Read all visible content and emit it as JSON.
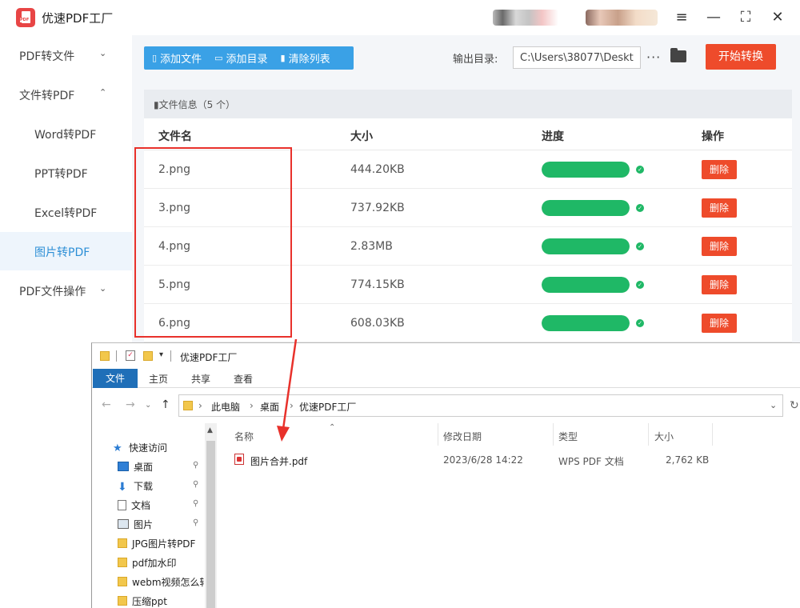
{
  "app": {
    "title": "优速PDF工厂",
    "window_buttons": [
      "≡",
      "—",
      "⛶",
      "✕"
    ]
  },
  "sidebar": {
    "items": [
      {
        "label": "PDF转文件",
        "chevron": "⌄"
      },
      {
        "label": "文件转PDF",
        "chevron": "⌃"
      },
      {
        "label": "Word转PDF"
      },
      {
        "label": "PPT转PDF"
      },
      {
        "label": "Excel转PDF"
      },
      {
        "label": "图片转PDF"
      },
      {
        "label": "PDF文件操作",
        "chevron": "⌄"
      }
    ],
    "active_index": 5
  },
  "toolbar": {
    "add_file": "添加文件",
    "add_dir": "添加目录",
    "clear_list": "清除列表",
    "output_label": "输出目录:",
    "output_path": "C:\\Users\\38077\\Deskto",
    "more": "···",
    "start": "开始转换"
  },
  "file_panel": {
    "info_label": "文件信息（5 个）",
    "columns": [
      "文件名",
      "大小",
      "进度",
      "操作"
    ],
    "rows": [
      {
        "name": "2.png",
        "size": "444.20KB",
        "progress": 1.0,
        "action": "删除"
      },
      {
        "name": "3.png",
        "size": "737.92KB",
        "progress": 1.0,
        "action": "删除"
      },
      {
        "name": "4.png",
        "size": "2.83MB",
        "progress": 1.0,
        "action": "删除"
      },
      {
        "name": "5.png",
        "size": "774.15KB",
        "progress": 1.0,
        "action": "删除"
      },
      {
        "name": "6.png",
        "size": "608.03KB",
        "progress": 1.0,
        "action": "删除"
      }
    ]
  },
  "explorer": {
    "title": "优速PDF工厂",
    "ribbon_tabs": [
      "文件",
      "主页",
      "共享",
      "查看"
    ],
    "breadcrumb": [
      "此电脑",
      "桌面",
      "优速PDF工厂"
    ],
    "tree": [
      {
        "label": "快速访问",
        "icon": "star-icon"
      },
      {
        "label": "桌面",
        "icon": "desktop-icon",
        "pinned": true
      },
      {
        "label": "下载",
        "icon": "download-icon",
        "pinned": true
      },
      {
        "label": "文档",
        "icon": "document-icon",
        "pinned": true
      },
      {
        "label": "图片",
        "icon": "picture-icon",
        "pinned": true
      },
      {
        "label": "JPG图片转PDF",
        "icon": "folder-icon"
      },
      {
        "label": "pdf加水印",
        "icon": "folder-icon"
      },
      {
        "label": "webm视频怎么转",
        "icon": "folder-icon"
      },
      {
        "label": "压缩ppt",
        "icon": "folder-icon"
      }
    ],
    "columns": [
      "名称",
      "修改日期",
      "类型",
      "大小"
    ],
    "files": [
      {
        "name": "图片合并.pdf",
        "modified": "2023/6/28 14:22",
        "type": "WPS PDF 文档",
        "size": "2,762 KB"
      }
    ]
  },
  "colors": {
    "accent_blue": "#3aa1e6",
    "start_red": "#ee4b2b",
    "progress_green": "#1fb866",
    "annotation_red": "#e8312b"
  }
}
